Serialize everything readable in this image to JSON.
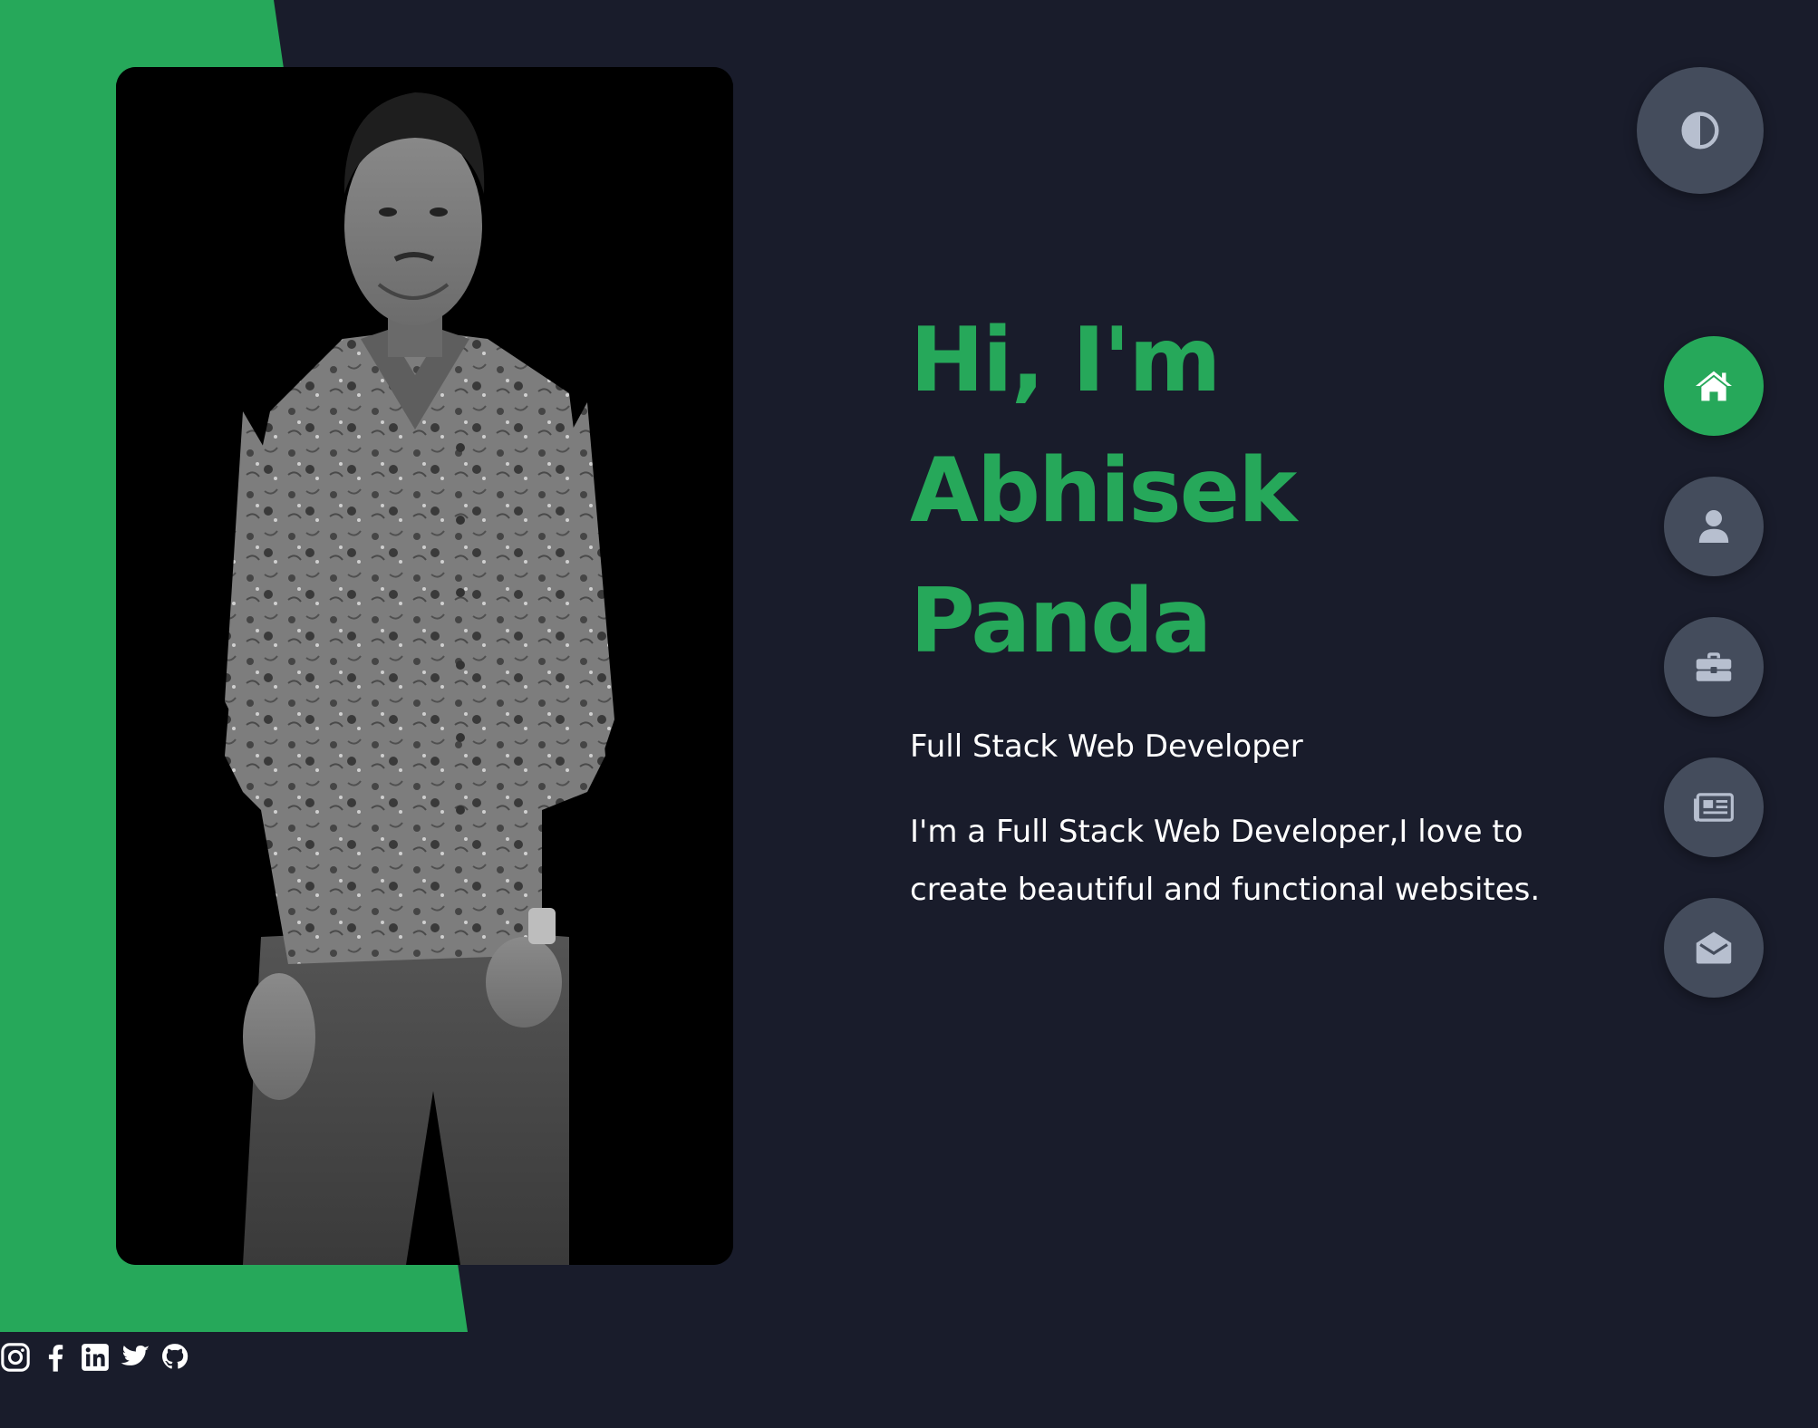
{
  "colors": {
    "background": "#191c2b",
    "accent": "#26a85a",
    "button_bg": "#444c5c",
    "icon_muted": "#b7bfcf",
    "text": "#ffffff"
  },
  "portrait": {
    "alt": "Abhisek Panda"
  },
  "hero": {
    "greeting": "Hi, I'm",
    "first_name": "Abhisek",
    "last_name": "Panda",
    "subtitle": "Full Stack Web Developer",
    "description": "I'm a Full Stack Web Developer,I love to create beautiful and functional websites."
  },
  "theme_toggle": {
    "icon": "half-circle-icon"
  },
  "nav": {
    "items": [
      {
        "name": "home",
        "icon": "home-icon",
        "active": true
      },
      {
        "name": "about",
        "icon": "user-icon",
        "active": false
      },
      {
        "name": "portfolio",
        "icon": "briefcase-icon",
        "active": false
      },
      {
        "name": "blog",
        "icon": "newspaper-icon",
        "active": false
      },
      {
        "name": "contact",
        "icon": "envelope-open-icon",
        "active": false
      }
    ]
  },
  "social": {
    "items": [
      {
        "name": "instagram",
        "icon": "instagram-icon"
      },
      {
        "name": "facebook",
        "icon": "facebook-icon"
      },
      {
        "name": "linkedin",
        "icon": "linkedin-icon"
      },
      {
        "name": "twitter",
        "icon": "twitter-icon"
      },
      {
        "name": "github",
        "icon": "github-icon"
      }
    ]
  }
}
